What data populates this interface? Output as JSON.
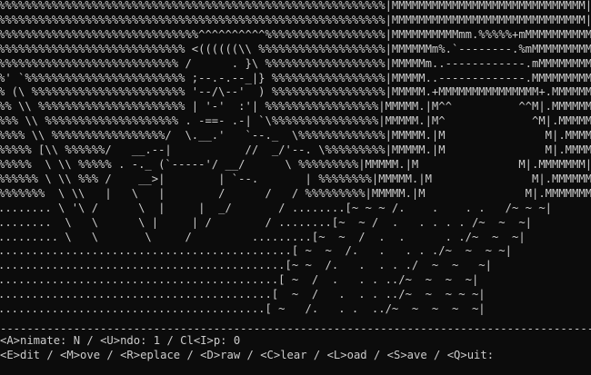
{
  "canvas_lines": [
    "%%%%%%%%%%%%%%%%%%%%%%%%%%%%%%%%%%%%%%%%%%%%%%%%%%%%%%%%%%|MMMMMMMMMMMMMMMMMMMMMMMMMMMMM|",
    "%%%%%%%%%%%%%%%%%%%%%%%%%%%%%%%%%%%%%%%%%%%%%%%%%%%%%%%%%%|MMMMMMMMMMMMMMMMMMMMMMMMMMMMM|",
    "%%%%%%%%%%%%%%%%%%%%%%%%%%%%%%^^^^^^^^^^%%%%%%%%%%%%%%%%%%|MMMMMMMMMMmm.%%%%%+mMMMMMMMMMM|",
    "%%%%%%%%%%%%%%%%%%%%%%%%%%%% <((((((\\\\ %%%%%%%%%%%%%%%%%%%|MMMMMMm%.`--------.%mMMMMMMMMM|",
    "%%%%%%%%%%%%%%%%%%%%%%%%%%% /      . }\\ %%%%%%%%%%%%%%%%%%|MMMMMm..------------.mMMMMMMMM|",
    "%' `%%%%%%%%%%%%%%%%%%%%%%%% ;--.-.--_|} %%%%%%%%%%%%%%%%%|MMMMM..-------------.MMMMMMMMM|",
    "% (\\ %%%%%%%%%%%%%%%%%%%%%%% '--/\\--'  ) %%%%%%%%%%%%%%%%%|MMMMM.+MMMMMMMMMMMMMMM+.MMMMMMM|",
    "%% \\\\ %%%%%%%%%%%%%%%%%%%%%% | '-'  :'| %%%%%%%%%%%%%%%%%|MMMMM.|M^^          ^^M|.MMMMMMM|",
    "%%% \\\\ %%%%%%%%%%%%%%%%%%%% . -==- .-| `\\%%%%%%%%%%%%%%%%|MMMMM.|M^             ^M|.MMMMMMM|",
    "%%%% \\\\ %%%%%%%%%%%%%%%%%/  \\.__.'   `--._  \\%%%%%%%%%%%%%|MMMMM.|M               M|.MMMMMMM|",
    "%%%%% [\\\\ %%%%%%/   __.--|           //  _/'--. \\%%%%%%%%%|MMMMM.|M               M|.MMMMMMM|",
    "%%%%%  \\ \\\\ %%%%% . -._ (`-----'/ __/      \\ %%%%%%%%%|MMMMM.|M               M|.MMMMMMM|",
    "%%%%%% \\ \\\\ %%% /    __>|        | `--.       | %%%%%%%%|MMMMM.|M               M|.MMMMMMM|",
    "%%%%%%%  \\ \\\\   |   \\   |        /      /   / %%%%%%%%%|MMMMM.|M               M|.MMMMMMM|",
    "........ \\ '\\ /      \\  |     |  _/       / ........[~ ~ ~ /.    .    . .   /~ ~ ~|",
    "........  \\   \\      \\ |     | /        / ........[~  ~ /  .   . . . . /~  ~  ~|",
    "......... \\   \\       \\     /         .........[~  ~  /  .  .      . ./~  ~  ~|",
    "............................................[ ~  ~  /.   .   . . ./~  ~  ~ ~|",
    "...........................................[~ ~  /.   .  . . ./  ~  ~   ~|",
    "..........................................[ ~  /  .   . . ../~  ~  ~  ~|",
    ".........................................[  ~  /   .  . . ../~  ~  ~ ~ ~|",
    "........................................[ ~   /.   . .  ../~  ~  ~  ~  ~|"
  ],
  "divider": "------------------------------------------------------------------------------------------------------",
  "status": {
    "animate_label": "<A>nimate: N",
    "sep1": " / ",
    "undo_label": "<U>ndo: 1",
    "sep2": " / ",
    "clip_label": "Cl<I>p: 0"
  },
  "menu": {
    "edit": "<E>dit",
    "move": "<M>ove",
    "replace": "<R>eplace",
    "draw": "<D>raw",
    "clear": "<C>lear",
    "load": "<L>oad",
    "save": "<S>ave",
    "quit": "<Q>uit:",
    "sep": " / "
  },
  "colors": {
    "background": "#0c0c0c",
    "foreground": "#cccccc"
  }
}
